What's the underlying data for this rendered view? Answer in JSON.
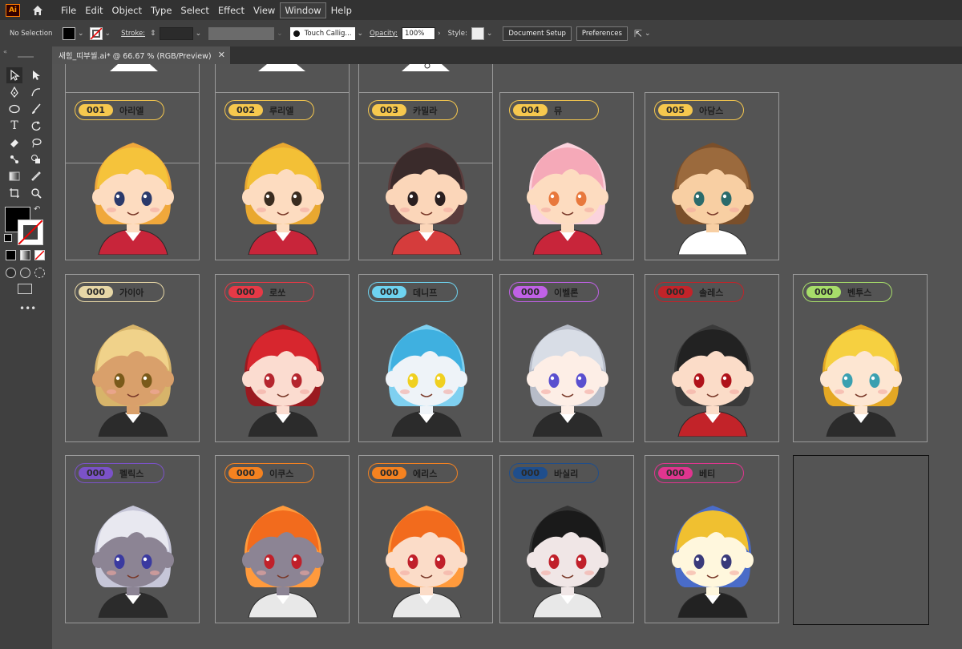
{
  "app": {
    "logo": "Ai"
  },
  "menu": [
    "File",
    "Edit",
    "Object",
    "Type",
    "Select",
    "Effect",
    "View",
    "Window",
    "Help"
  ],
  "menu_active": "Window",
  "control": {
    "selection": "No Selection",
    "stroke_label": "Stroke:",
    "brush": "Touch Callig...",
    "opacity_label": "Opacity:",
    "opacity_value": "100%",
    "style_label": "Style:",
    "doc_setup": "Document Setup",
    "preferences": "Preferences"
  },
  "document_tab": {
    "title": "새힘_띠부씰.ai* @ 66.67 % (RGB/Preview)"
  },
  "cards": [
    {
      "num": "001",
      "name": "아리엘",
      "color": "#f6c84e",
      "hair": "#f5c33b",
      "hair2": "#f0a83b",
      "eye": "#2b3a6b",
      "skin": "#fddcc0",
      "outfit": "#c8253a"
    },
    {
      "num": "002",
      "name": "루리엘",
      "color": "#f6c84e",
      "hair": "#f3c036",
      "hair2": "#e9a830",
      "eye": "#3a2c1f",
      "skin": "#fddcc0",
      "outfit": "#c8253a"
    },
    {
      "num": "003",
      "name": "카밀라",
      "color": "#f6c84e",
      "hair": "#3a2b2b",
      "hair2": "#5a3c3c",
      "eye": "#2a1f1f",
      "skin": "#fbd6b9",
      "outfit": "#d53c3c"
    },
    {
      "num": "004",
      "name": "뮤",
      "color": "#f6c84e",
      "hair": "#f5a9b8",
      "hair2": "#fbd3dd",
      "eye": "#e8783c",
      "skin": "#fddcc0",
      "outfit": "#c8253a"
    },
    {
      "num": "005",
      "name": "아담스",
      "color": "#f6c84e",
      "hair": "#9b6a3d",
      "hair2": "#7a4f2b",
      "eye": "#2b6b6b",
      "skin": "#f8cfa3",
      "outfit": "#ffffff"
    },
    {
      "num": "000",
      "name": "가이아",
      "color": "#e7d7a6",
      "hair": "#f0d28a",
      "hair2": "#d7b46a",
      "eye": "#7a5a1a",
      "skin": "#d9a06b",
      "outfit": "#2b2b2b"
    },
    {
      "num": "000",
      "name": "로쏘",
      "color": "#e63946",
      "hair": "#d7262e",
      "hair2": "#9a1a20",
      "eye": "#b5262e",
      "skin": "#fbdcd0",
      "outfit": "#2b2b2b"
    },
    {
      "num": "000",
      "name": "데니프",
      "color": "#6ed3f0",
      "hair": "#3fb0e0",
      "hair2": "#7fd0f0",
      "eye": "#f0d020",
      "skin": "#eef3f8",
      "outfit": "#2b2b2b"
    },
    {
      "num": "000",
      "name": "이벨론",
      "color": "#c061e6",
      "hair": "#d8dde6",
      "hair2": "#b7bcc8",
      "eye": "#5a4fcf",
      "skin": "#fdeee6",
      "outfit": "#2b2b2b"
    },
    {
      "num": "000",
      "name": "솔레스",
      "color": "#c22329",
      "hair": "#222222",
      "hair2": "#3a3a3a",
      "eye": "#b0121a",
      "skin": "#fbdcc8",
      "outfit": "#c22329"
    },
    {
      "num": "000",
      "name": "벤투스",
      "color": "#a7dd6a",
      "hair": "#f6d040",
      "hair2": "#e4a824",
      "eye": "#3aa0b0",
      "skin": "#fde6d2",
      "outfit": "#2b2b2b"
    },
    {
      "num": "000",
      "name": "펠릭스",
      "color": "#7b52c8",
      "hair": "#e8e8f0",
      "hair2": "#c6c6d8",
      "eye": "#3a3aa0",
      "skin": "#8c8494",
      "outfit": "#2b2b2b"
    },
    {
      "num": "000",
      "name": "이쿠스",
      "color": "#f58220",
      "hair": "#f26b1d",
      "hair2": "#ff9a3c",
      "eye": "#c0202a",
      "skin": "#8c8494",
      "outfit": "#e8e8e8"
    },
    {
      "num": "000",
      "name": "에리스",
      "color": "#f58220",
      "hair": "#f26b1d",
      "hair2": "#ff9a3c",
      "eye": "#c0202a",
      "skin": "#fbdcc8",
      "outfit": "#e8e8e8"
    },
    {
      "num": "000",
      "name": "바실리",
      "color": "#1f4e8c",
      "hair": "#1a1a1a",
      "hair2": "#333333",
      "eye": "#c0202a",
      "skin": "#f0e6e6",
      "outfit": "#e8e8e8"
    },
    {
      "num": "000",
      "name": "베티",
      "color": "#e0358f",
      "hair": "#f0c030",
      "hair2": "#4a6cc8",
      "eye": "#3a3a7a",
      "skin": "#fff7dd",
      "outfit": "#222222"
    }
  ]
}
